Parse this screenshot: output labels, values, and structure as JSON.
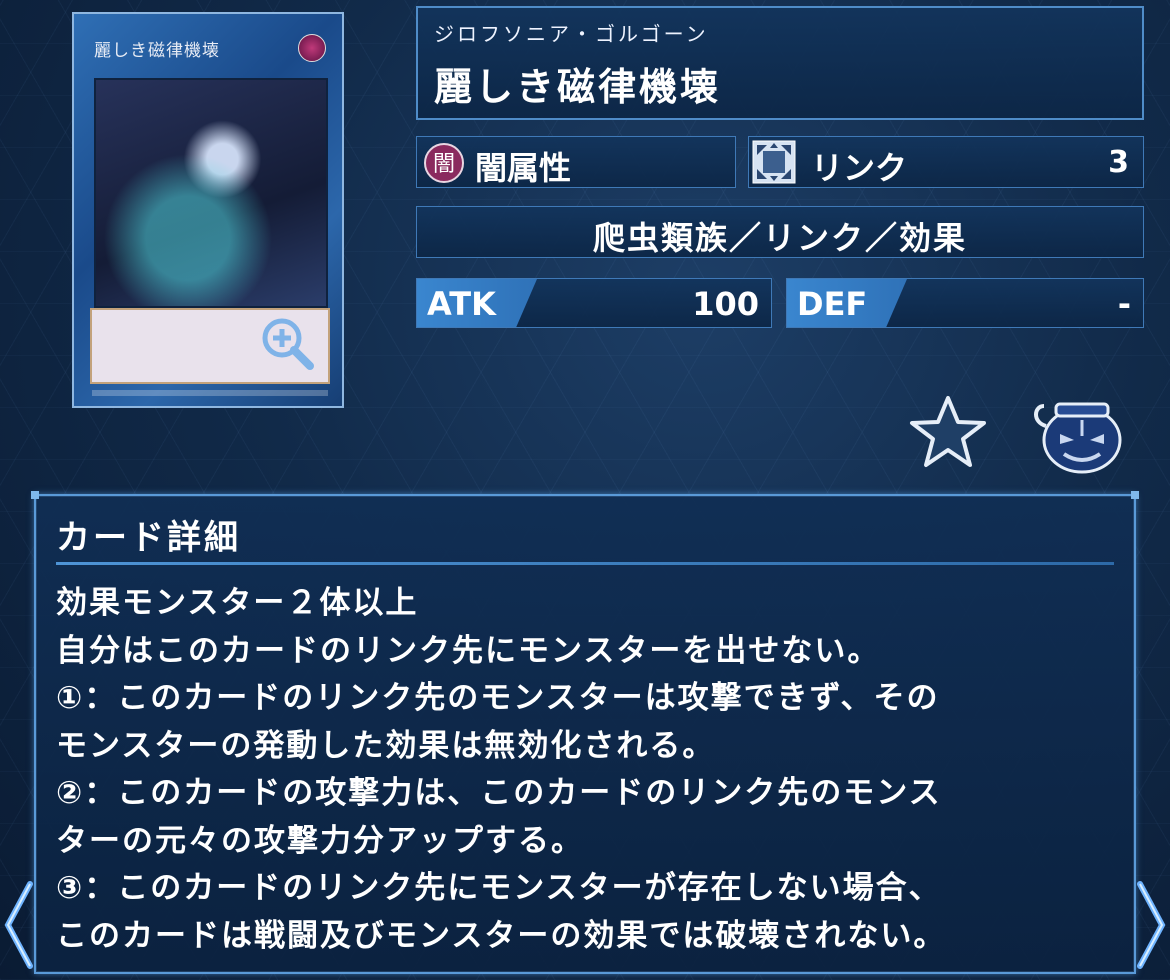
{
  "card": {
    "image_title": "麗しき磁律機壊",
    "zoom_icon": "zoom-in-icon"
  },
  "header": {
    "ruby": "ジロフソニア・ゴルゴーン",
    "title": "麗しき磁律機壊"
  },
  "attribute": {
    "icon_glyph": "闇",
    "label": "闇属性"
  },
  "link": {
    "label": "リンク",
    "value": "3"
  },
  "type_line": "爬虫類族／リンク／効果",
  "stats": {
    "atk_label": "ATK",
    "atk_value": "100",
    "def_label": "DEF",
    "def_value": "-"
  },
  "actions": {
    "favorite_icon": "star-icon",
    "deck_icon": "pot-icon"
  },
  "detail": {
    "title": "カード詳細",
    "text": "効果モンスター２体以上\n自分はこのカードのリンク先にモンスターを出せない。\n①：このカードのリンク先のモンスターは攻撃できず、その\nモンスターの発動した効果は無効化される。\n②：このカードの攻撃力は、このカードのリンク先のモンス\nターの元々の攻撃力分アップする。\n③：このカードのリンク先にモンスターが存在しない場合、\nこのカードは戦闘及びモンスターの効果では破壊されない。"
  },
  "colors": {
    "background": "#112a49",
    "panel_border": "#4f8cc8",
    "accent": "#3a86cf"
  }
}
